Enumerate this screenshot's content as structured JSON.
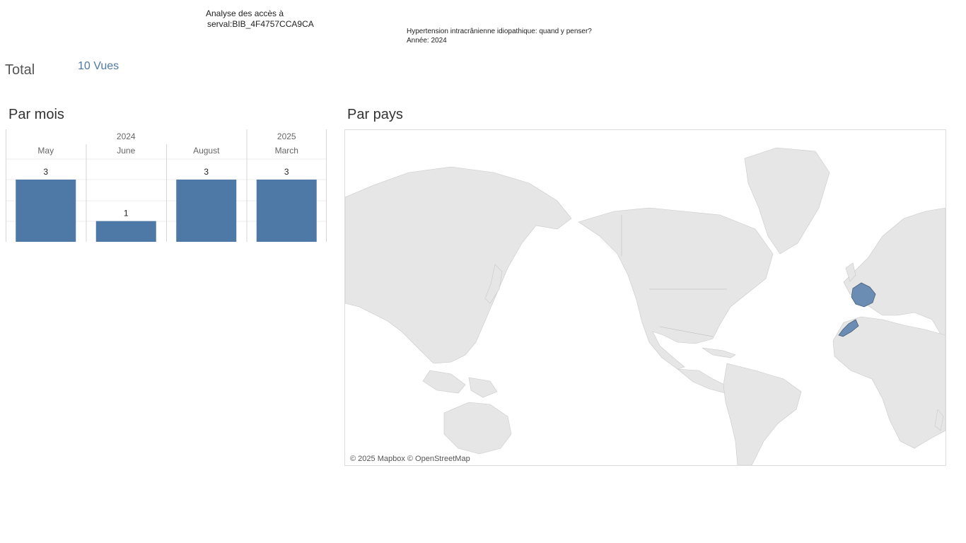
{
  "header": {
    "access_title_line1": "Analyse des accès à",
    "access_title_line2": "serval:BIB_4F4757CCA9CA",
    "doc_title": "Hypertension intracrânienne idiopathique: quand y penser?",
    "doc_year": "Année: 2024"
  },
  "total": {
    "label": "Total",
    "value": "10 Vues"
  },
  "sections": {
    "by_month": "Par mois",
    "by_country": "Par pays"
  },
  "chart_data": [
    {
      "type": "bar",
      "title": "Par mois",
      "categories": [
        "May",
        "June",
        "August",
        "March"
      ],
      "years": [
        {
          "label": "2024",
          "months": [
            "May",
            "June",
            "August"
          ]
        },
        {
          "label": "2025",
          "months": [
            "March"
          ]
        }
      ],
      "values": [
        3,
        1,
        3,
        3
      ],
      "data_labels": [
        "3",
        "1",
        "3",
        "3"
      ],
      "ylim": [
        0,
        3
      ],
      "grid": true,
      "bar_color": "#4e79a7"
    },
    {
      "type": "map",
      "title": "Par pays",
      "highlighted_countries": [
        "France",
        "Morocco"
      ],
      "highlight_color": "#6b8db3",
      "land_color": "#e6e6e6",
      "attribution": "© 2025 Mapbox © OpenStreetMap"
    }
  ]
}
